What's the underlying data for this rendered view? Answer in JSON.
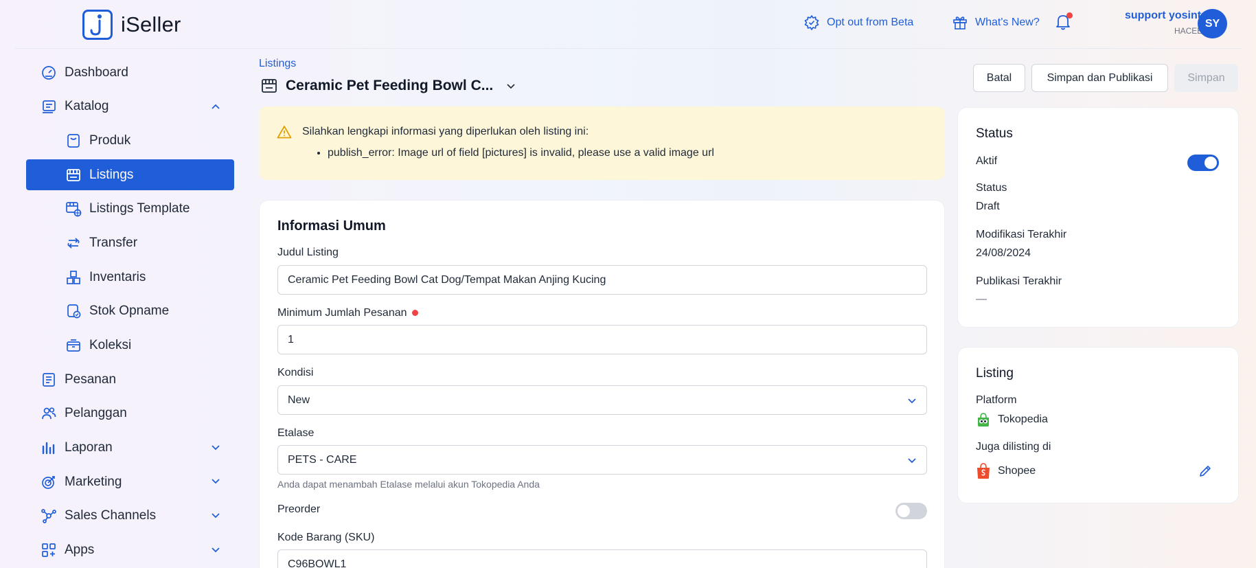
{
  "app": {
    "name": "iSeller"
  },
  "header": {
    "opt_out": "Opt out from Beta",
    "whats_new": "What's New?",
    "user_name": "support yosinta",
    "user_org": "HACEEL",
    "avatar_initials": "SY"
  },
  "sidebar": {
    "items": [
      {
        "label": "Dashboard"
      },
      {
        "label": "Katalog"
      },
      {
        "label": "Produk"
      },
      {
        "label": "Listings"
      },
      {
        "label": "Listings Template"
      },
      {
        "label": "Transfer"
      },
      {
        "label": "Inventaris"
      },
      {
        "label": "Stok Opname"
      },
      {
        "label": "Koleksi"
      },
      {
        "label": "Pesanan"
      },
      {
        "label": "Pelanggan"
      },
      {
        "label": "Laporan"
      },
      {
        "label": "Marketing"
      },
      {
        "label": "Sales Channels"
      },
      {
        "label": "Apps"
      }
    ]
  },
  "page": {
    "breadcrumb": "Listings",
    "title": "Ceramic Pet Feeding Bowl C...",
    "buttons": {
      "cancel": "Batal",
      "save_publish": "Simpan dan Publikasi",
      "save": "Simpan"
    }
  },
  "alert": {
    "message": "Silahkan lengkapi informasi yang diperlukan oleh listing ini:",
    "errors": [
      "publish_error: Image url of field [pictures] is invalid, please use a valid image url"
    ]
  },
  "general": {
    "title": "Informasi Umum",
    "listing_title_label": "Judul Listing",
    "listing_title_value": "Ceramic Pet Feeding Bowl Cat Dog/Tempat Makan Anjing Kucing",
    "min_order_label": "Minimum Jumlah Pesanan",
    "min_order_value": "1",
    "condition_label": "Kondisi",
    "condition_value": "New",
    "etalase_label": "Etalase",
    "etalase_value": "PETS - CARE",
    "etalase_hint": "Anda dapat menambah Etalase melalui akun Tokopedia Anda",
    "preorder_label": "Preorder",
    "preorder_on": false,
    "sku_label": "Kode Barang (SKU)",
    "sku_value": "C96BOWL1"
  },
  "status_card": {
    "title": "Status",
    "active_label": "Aktif",
    "active_on": true,
    "status_label": "Status",
    "status_value": "Draft",
    "modified_label": "Modifikasi Terakhir",
    "modified_value": "24/08/2024",
    "published_label": "Publikasi Terakhir",
    "published_value": "—"
  },
  "listing_card": {
    "title": "Listing",
    "platform_label": "Platform",
    "platform_value": "Tokopedia",
    "also_listed_label": "Juga dilisting di",
    "also_listed_value": "Shopee"
  },
  "colors": {
    "primary": "#1f5ed8",
    "alert_bg": "#fdf6d8",
    "danger": "#ef4444"
  }
}
